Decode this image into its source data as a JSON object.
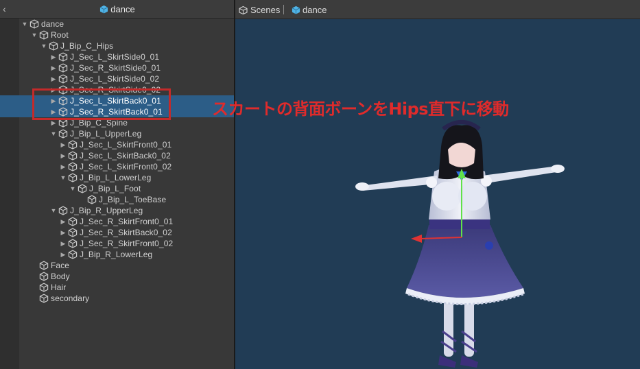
{
  "hierarchy": {
    "back_glyph": "‹",
    "title": "dance",
    "rows": [
      {
        "label": "dance",
        "depth": 0,
        "arrow": "down",
        "selected": false
      },
      {
        "label": "Root",
        "depth": 1,
        "arrow": "down",
        "selected": false
      },
      {
        "label": "J_Bip_C_Hips",
        "depth": 2,
        "arrow": "down",
        "selected": false
      },
      {
        "label": "J_Sec_L_SkirtSide0_01",
        "depth": 3,
        "arrow": "right",
        "selected": false
      },
      {
        "label": "J_Sec_R_SkirtSide0_01",
        "depth": 3,
        "arrow": "right",
        "selected": false
      },
      {
        "label": "J_Sec_L_SkirtSide0_02",
        "depth": 3,
        "arrow": "right",
        "selected": false
      },
      {
        "label": "J_Sec_R_SkirtSide0_02",
        "depth": 3,
        "arrow": "right",
        "selected": false
      },
      {
        "label": "J_Sec_L_SkirtBack0_01",
        "depth": 3,
        "arrow": "right",
        "selected": true
      },
      {
        "label": "J_Sec_R_SkirtBack0_01",
        "depth": 3,
        "arrow": "right",
        "selected": true
      },
      {
        "label": "J_Bip_C_Spine",
        "depth": 3,
        "arrow": "right",
        "selected": false
      },
      {
        "label": "J_Bip_L_UpperLeg",
        "depth": 3,
        "arrow": "down",
        "selected": false
      },
      {
        "label": "J_Sec_L_SkirtFront0_01",
        "depth": 4,
        "arrow": "right",
        "selected": false
      },
      {
        "label": "J_Sec_L_SkirtBack0_02",
        "depth": 4,
        "arrow": "right",
        "selected": false
      },
      {
        "label": "J_Sec_L_SkirtFront0_02",
        "depth": 4,
        "arrow": "right",
        "selected": false
      },
      {
        "label": "J_Bip_L_LowerLeg",
        "depth": 4,
        "arrow": "down",
        "selected": false
      },
      {
        "label": "J_Bip_L_Foot",
        "depth": 5,
        "arrow": "down",
        "selected": false
      },
      {
        "label": "J_Bip_L_ToeBase",
        "depth": 6,
        "arrow": "none",
        "selected": false
      },
      {
        "label": "J_Bip_R_UpperLeg",
        "depth": 3,
        "arrow": "down",
        "selected": false
      },
      {
        "label": "J_Sec_R_SkirtFront0_01",
        "depth": 4,
        "arrow": "right",
        "selected": false
      },
      {
        "label": "J_Sec_R_SkirtBack0_02",
        "depth": 4,
        "arrow": "right",
        "selected": false
      },
      {
        "label": "J_Sec_R_SkirtFront0_02",
        "depth": 4,
        "arrow": "right",
        "selected": false
      },
      {
        "label": "J_Bip_R_LowerLeg",
        "depth": 4,
        "arrow": "right",
        "selected": false
      },
      {
        "label": "Face",
        "depth": 1,
        "arrow": "none",
        "selected": false
      },
      {
        "label": "Body",
        "depth": 1,
        "arrow": "none",
        "selected": false
      },
      {
        "label": "Hair",
        "depth": 1,
        "arrow": "none",
        "selected": false
      },
      {
        "label": "secondary",
        "depth": 1,
        "arrow": "none",
        "selected": false
      }
    ]
  },
  "scene": {
    "breadcrumb_scenes": "Scenes",
    "breadcrumb_prefab": "dance",
    "icons": {
      "scenes": "unity-logo-icon",
      "prefab": "prefab-cube-icon"
    }
  },
  "annotation": {
    "text": "スカートの背面ボーンをHips直下に移動",
    "color": "#e02b2b"
  },
  "colors": {
    "panel_bg": "#383838",
    "selection": "#2c5d87",
    "scene_bg": "#213c55",
    "prefab_cube": "#4fb3e6"
  }
}
